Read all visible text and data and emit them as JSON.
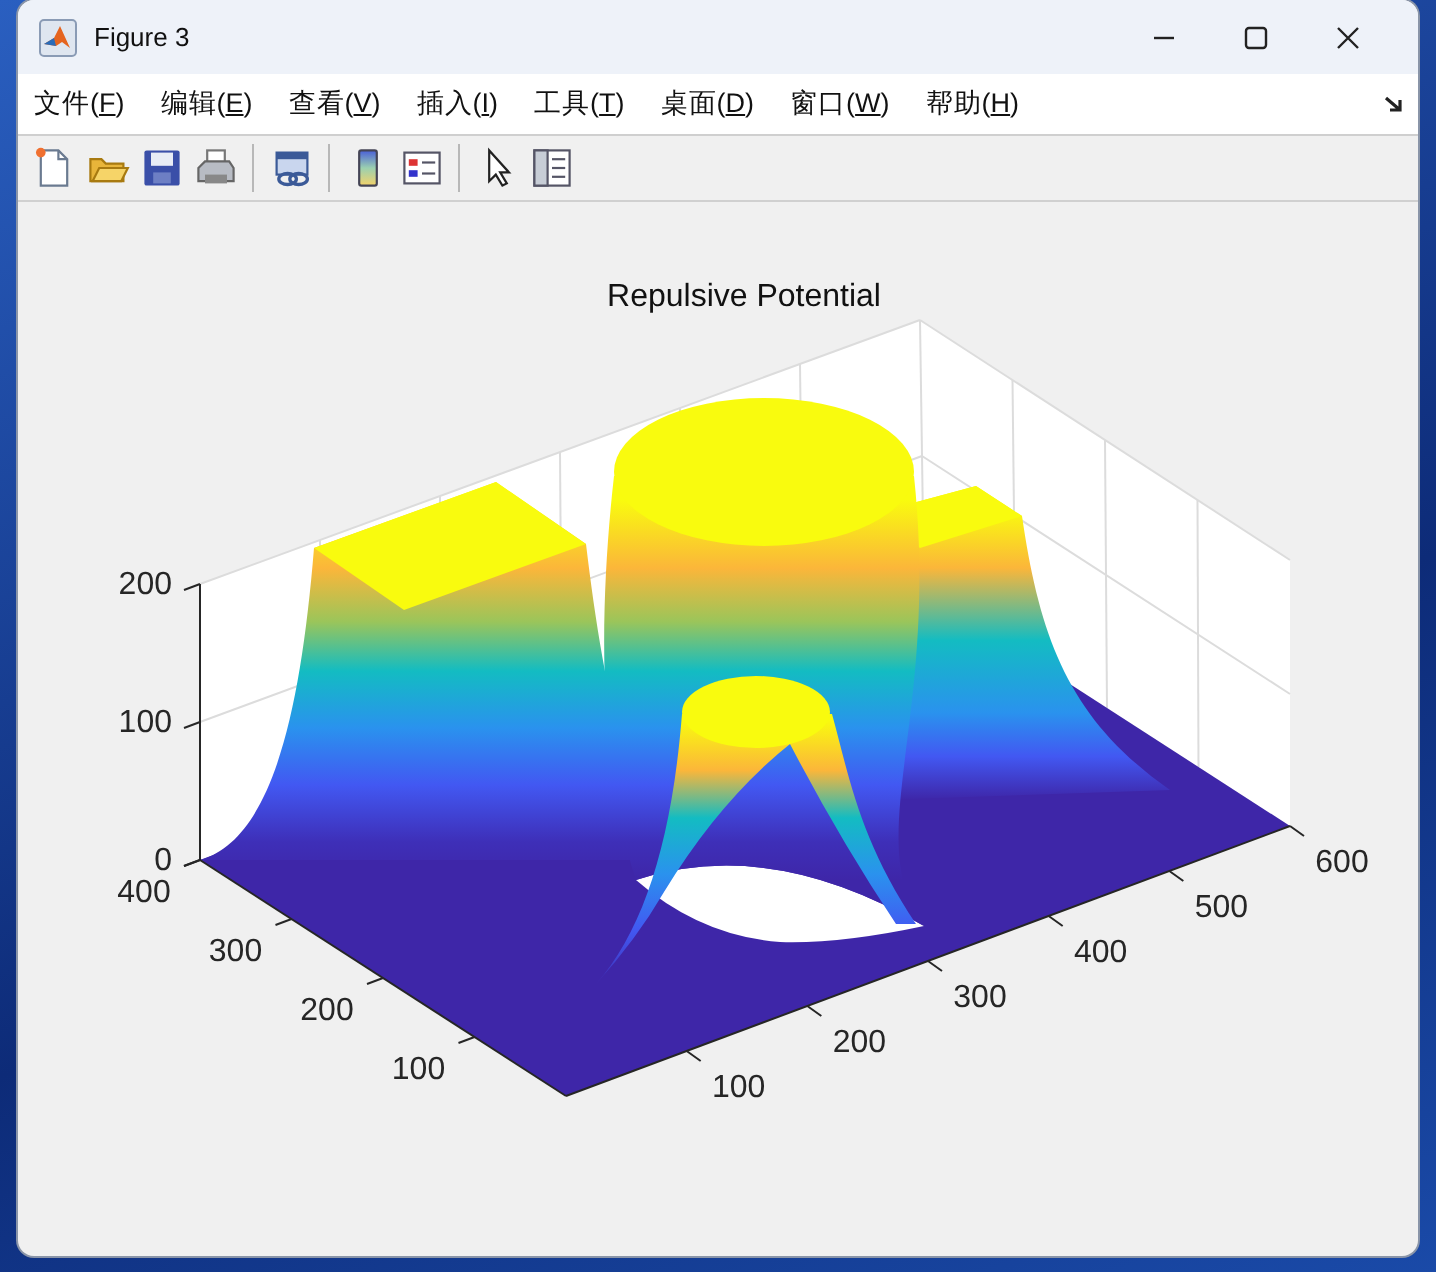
{
  "window": {
    "title": "Figure 3"
  },
  "menu": [
    {
      "before": "文件(",
      "key": "F",
      "after": ")"
    },
    {
      "before": "编辑(",
      "key": "E",
      "after": ")"
    },
    {
      "before": "查看(",
      "key": "V",
      "after": ")"
    },
    {
      "before": "插入(",
      "key": "I",
      "after": ")"
    },
    {
      "before": "工具(",
      "key": "T",
      "after": ")"
    },
    {
      "before": "桌面(",
      "key": "D",
      "after": ")"
    },
    {
      "before": "窗口(",
      "key": "W",
      "after": ")"
    },
    {
      "before": "帮助(",
      "key": "H",
      "after": ")"
    }
  ],
  "toolbar": [
    {
      "kind": "new"
    },
    {
      "kind": "open"
    },
    {
      "kind": "save"
    },
    {
      "kind": "print"
    },
    {
      "kind": "separator"
    },
    {
      "kind": "link"
    },
    {
      "kind": "separator"
    },
    {
      "kind": "colorbar"
    },
    {
      "kind": "legend"
    },
    {
      "kind": "separator"
    },
    {
      "kind": "pointer"
    },
    {
      "kind": "panel"
    }
  ],
  "axes": {
    "title": "Repulsive Potential",
    "z_ticks": [
      "200",
      "100",
      "0"
    ],
    "y_ticks": [
      "100",
      "200",
      "300",
      "400"
    ],
    "x_ticks": [
      "100",
      "200",
      "300",
      "400",
      "500",
      "600"
    ]
  }
}
